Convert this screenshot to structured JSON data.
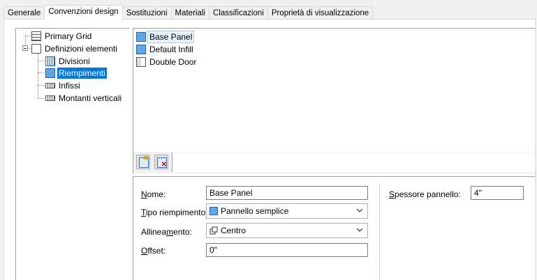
{
  "tabs": [
    "Generale",
    "Convenzioni design",
    "Sostituzioni",
    "Materiali",
    "Classificazioni",
    "Proprietà di visualizzazione"
  ],
  "active_tab": "Convenzioni design",
  "tree": {
    "items": [
      {
        "label": "Primary Grid",
        "icon": "grid-icon"
      },
      {
        "label": "Definizioni elementi",
        "icon": "folder-icon"
      },
      {
        "label": "Divisioni",
        "icon": "division-icon"
      },
      {
        "label": "Riempimenti",
        "icon": "infill-icon",
        "selected": true
      },
      {
        "label": "Infissi",
        "icon": "frame-icon"
      },
      {
        "label": "Montanti verticali",
        "icon": "mullion-icon"
      }
    ]
  },
  "list": {
    "items": [
      {
        "label": "Base Panel",
        "icon": "panel-icon",
        "selected": true
      },
      {
        "label": "Default Infill",
        "icon": "panel-icon"
      },
      {
        "label": "Double Door",
        "icon": "door-icon"
      }
    ]
  },
  "toolbar": {
    "add_icon": "new-infill-icon",
    "delete_icon": "delete-infill-icon"
  },
  "props": {
    "name_label_u": "N",
    "name_label_rest": "ome:",
    "name_value": "Base Panel",
    "type_label_u": "T",
    "type_label_rest": "ipo riempimento:",
    "type_value": "Pannello semplice",
    "align_label_pre": "Allinea",
    "align_label_u": "m",
    "align_label_rest": "ento:",
    "align_value": "Centro",
    "offset_label_u": "O",
    "offset_label_rest": "ffset:",
    "offset_value": "0\"",
    "thickness_label_u": "S",
    "thickness_label_rest": "pessore pannello:",
    "thickness_value": "4\""
  },
  "colors": {
    "selection": "#0078d7",
    "panel_blue": "#5ea7e8"
  }
}
